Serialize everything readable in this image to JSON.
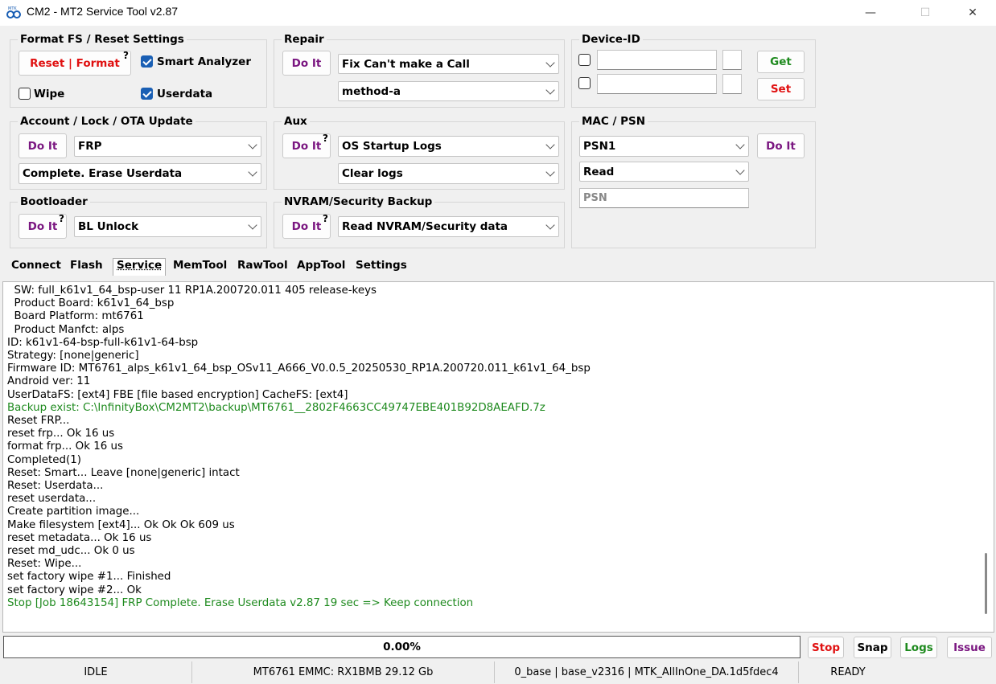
{
  "window": {
    "title": "CM2 - MT2 Service Tool v2.87",
    "minimize": "—",
    "maximize": "☐",
    "close": "✕"
  },
  "colors": {
    "red": "#e01010",
    "purple": "#7a1680",
    "green": "#1e8a1e",
    "blue": "#1a5fb4"
  },
  "format_fs": {
    "title": "Format FS / Reset Settings",
    "reset_part1": "Reset",
    "reset_sep": " | ",
    "reset_part2": "Format",
    "help": "?",
    "smart_analyzer": {
      "label": "Smart Analyzer",
      "checked": true
    },
    "wipe": {
      "label": "Wipe",
      "checked": false
    },
    "userdata": {
      "label": "Userdata",
      "checked": true
    }
  },
  "repair": {
    "title": "Repair",
    "do_it": "Do It",
    "combo1": "Fix Can't make a Call",
    "combo2": "method-a"
  },
  "device_id": {
    "title": "Device-ID",
    "get": "Get",
    "set": "Set"
  },
  "account": {
    "title": "Account / Lock / OTA Update",
    "do_it": "Do It",
    "combo1": "FRP",
    "combo2": "Complete. Erase Userdata"
  },
  "aux": {
    "title": "Aux",
    "do_it": "Do It",
    "help": "?",
    "combo1": "OS Startup Logs",
    "combo2": "Clear logs"
  },
  "mac_psn": {
    "title": "MAC / PSN",
    "combo1": "PSN1",
    "do_it": "Do It",
    "combo2": "Read",
    "psn_placeholder": "PSN"
  },
  "bootloader": {
    "title": "Bootloader",
    "do_it": "Do It",
    "help": "?",
    "combo": "BL Unlock"
  },
  "nvram": {
    "title": "NVRAM/Security Backup",
    "do_it": "Do It",
    "help": "?",
    "combo": "Read NVRAM/Security data"
  },
  "tabs": [
    "Connect",
    "Flash",
    "Service",
    "MemTool",
    "RawTool",
    "AppTool",
    "Settings"
  ],
  "active_tab": "Service",
  "log": [
    {
      "t": "  SW: full_k61v1_64_bsp-user 11 RP1A.200720.011 405 release-keys",
      "c": ""
    },
    {
      "t": "  Product Board: k61v1_64_bsp",
      "c": ""
    },
    {
      "t": "  Board Platform: mt6761",
      "c": ""
    },
    {
      "t": "  Product Manfct: alps",
      "c": ""
    },
    {
      "t": "ID: k61v1-64-bsp-full-k61v1-64-bsp",
      "c": ""
    },
    {
      "t": "Strategy: [none|generic]",
      "c": ""
    },
    {
      "t": "Firmware ID: MT6761_alps_k61v1_64_bsp_OSv11_A666_V0.0.5_20250530_RP1A.200720.011_k61v1_64_bsp",
      "c": ""
    },
    {
      "t": "Android ver: 11",
      "c": ""
    },
    {
      "t": "UserDataFS: [ext4] FBE [file based encryption] CacheFS: [ext4]",
      "c": ""
    },
    {
      "t": "Backup exist: C:\\InfinityBox\\CM2MT2\\backup\\MT6761__2802F4663CC49747EBE401B92D8AEAFD.7z",
      "c": "g"
    },
    {
      "t": "Reset FRP...",
      "c": ""
    },
    {
      "t": "reset frp... Ok 16 us",
      "c": ""
    },
    {
      "t": "format frp... Ok 16 us",
      "c": ""
    },
    {
      "t": "Completed(1)",
      "c": ""
    },
    {
      "t": "Reset: Smart... Leave [none|generic] intact",
      "c": ""
    },
    {
      "t": "Reset: Userdata...",
      "c": ""
    },
    {
      "t": "reset userdata...",
      "c": ""
    },
    {
      "t": "Create partition image...",
      "c": ""
    },
    {
      "t": "Make filesystem [ext4]... Ok Ok Ok 609 us",
      "c": ""
    },
    {
      "t": "reset metadata... Ok 16 us",
      "c": ""
    },
    {
      "t": "reset md_udc... Ok 0 us",
      "c": ""
    },
    {
      "t": "Reset: Wipe...",
      "c": ""
    },
    {
      "t": "set factory wipe #1... Finished",
      "c": ""
    },
    {
      "t": "set factory wipe #2... Ok",
      "c": ""
    },
    {
      "t": "Stop [Job 18643154] FRP Complete. Erase Userdata v2.87 19 sec => Keep connection",
      "c": "g"
    }
  ],
  "progress": {
    "text": "0.00%",
    "value": 0
  },
  "buttons": {
    "stop": "Stop",
    "snap": "Snap",
    "logs": "Logs",
    "issue": "Issue"
  },
  "status": {
    "state": "IDLE",
    "device": "MT6761 EMMC: RX1BMB 29.12 Gb",
    "base": "0_base | base_v2316 | MTK_AllInOne_DA.1d5fdec4",
    "ready": "READY"
  }
}
